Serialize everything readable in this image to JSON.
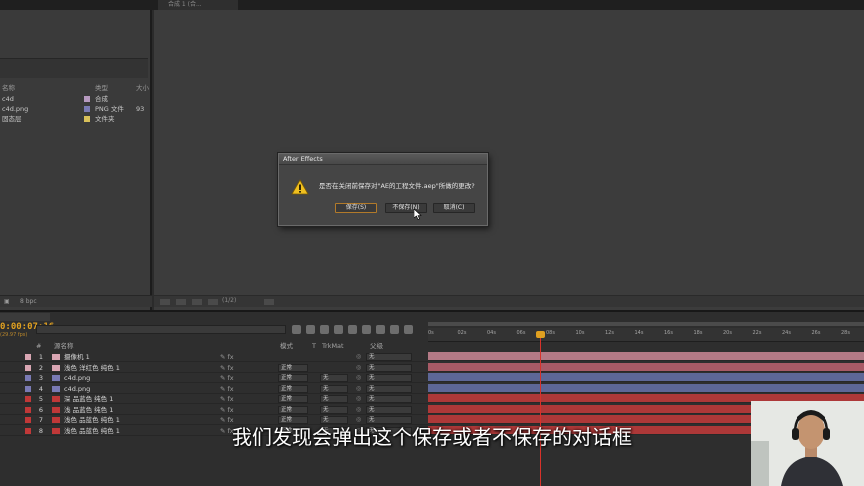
{
  "comp_tab": {
    "label": "合成 1 (合..."
  },
  "project": {
    "columns": {
      "name": "名称",
      "type": "类型",
      "size": "大小"
    },
    "items": [
      {
        "name": "c4d",
        "type": "合成",
        "color": "#b79ac0"
      },
      {
        "name": "c4d.png",
        "type": "PNG 文件",
        "size": "93",
        "color": "#7a7ab4"
      },
      {
        "name": "固态层",
        "type": "文件夹",
        "color": "#d8c05a"
      }
    ],
    "footer_bpc": "8 bpc"
  },
  "viewer": {
    "footer_text": "(1/2)"
  },
  "dialog": {
    "title": "After Effects",
    "message": "是否在关闭前保存对\"AE的工程文件.aep\"所做的更改?",
    "buttons": {
      "save": "保存(S)",
      "dont_save": "不保存(N)",
      "cancel": "取消(C)"
    }
  },
  "timeline": {
    "timecode": "0:00:07:16",
    "fps": "(29.97 fps)",
    "columns": {
      "num": "#",
      "name": "源名称",
      "mode": "模式",
      "t": "T",
      "trkmat": "TrkMat",
      "parent": "父级"
    },
    "ruler": [
      "0s",
      "02s",
      "04s",
      "06s",
      "08s",
      "10s",
      "12s",
      "14s",
      "16s",
      "18s",
      "20s",
      "22s",
      "24s",
      "26s",
      "28s"
    ],
    "layers": [
      {
        "num": "1",
        "name": "摄像机 1",
        "label_color": "#d9a6b3",
        "mode": "",
        "trkmat": "",
        "parent": "无",
        "track_color": "#b47a86"
      },
      {
        "num": "2",
        "name": "浅色 洋红色 纯色 1",
        "label_color": "#d9a6b3",
        "mode": "正常",
        "trkmat": "",
        "parent": "无",
        "track_color": "#a85a66"
      },
      {
        "num": "3",
        "name": "c4d.png",
        "label_color": "#7a7ab4",
        "mode": "正常",
        "trkmat": "无",
        "parent": "无",
        "track_color": "#5d6797"
      },
      {
        "num": "4",
        "name": "c4d.png",
        "label_color": "#7a7ab4",
        "mode": "正常",
        "trkmat": "无",
        "parent": "无",
        "track_color": "#5d6797"
      },
      {
        "num": "5",
        "name": "深 品蓝色 纯色 1",
        "label_color": "#c03838",
        "mode": "正常",
        "trkmat": "无",
        "parent": "无",
        "track_color": "#ad3838"
      },
      {
        "num": "6",
        "name": "浅 品蓝色 纯色 1",
        "label_color": "#c03838",
        "mode": "正常",
        "trkmat": "无",
        "parent": "无",
        "track_color": "#ad3838"
      },
      {
        "num": "7",
        "name": "浅色 品蓝色 纯色 1",
        "label_color": "#c03838",
        "mode": "正常",
        "trkmat": "无",
        "parent": "无",
        "track_color": "#ad3838"
      },
      {
        "num": "8",
        "name": "浅色 品蓝色 纯色 1",
        "label_color": "#c03838",
        "mode": "正常",
        "trkmat": "无",
        "parent": "无",
        "track_color": "#ad3838"
      }
    ]
  },
  "subtitle": "我们发现会弹出这个保存或者不保存的对话框",
  "colors": {
    "timecode": "#e0a020",
    "cti": "#d8322a"
  }
}
